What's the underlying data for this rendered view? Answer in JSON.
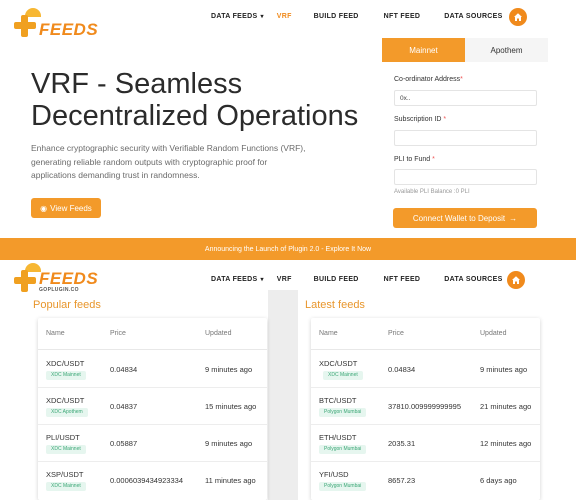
{
  "logo_top": {
    "brand": "FEEDS",
    "sub": ""
  },
  "logo_bottom": {
    "brand": "FEEDS",
    "sub": "GOPLUGIN.CO"
  },
  "nav": {
    "items": [
      {
        "label": "DATA FEEDS",
        "has_caret": true
      },
      {
        "label": "VRF",
        "active": true
      },
      {
        "label": "BUILD FEED"
      },
      {
        "label": "NFT FEED"
      },
      {
        "label": "DATA SOURCES"
      }
    ]
  },
  "nav2": {
    "items": [
      {
        "label": "DATA FEEDS",
        "has_caret": true
      },
      {
        "label": "VRF"
      },
      {
        "label": "BUILD FEED"
      },
      {
        "label": "NFT FEED"
      },
      {
        "label": "DATA SOURCES"
      }
    ]
  },
  "hero": {
    "title_line1": "VRF - Seamless",
    "title_line2": "Decentralized Operations",
    "description": "Enhance cryptographic security with Verifiable Random Functions (VRF), generating reliable random outputs with cryptographic proof for applications demanding trust in randomness.",
    "view_button": "View Feeds"
  },
  "form": {
    "tabs": [
      "Mainnet",
      "Apothem"
    ],
    "coordinator_label": "Co-ordinator Address",
    "coordinator_value": "0x..",
    "subscription_label": "Subscription ID",
    "subscription_value": "",
    "pli_label": "PLI to Fund",
    "pli_value": "",
    "balance_text": "Available PLI Balance :0 PLI",
    "connect_button": "Connect Wallet to Deposit"
  },
  "banner": {
    "text": "Announcing the Launch of Plugin 2.0 - Explore It Now"
  },
  "popular": {
    "title": "Popular feeds",
    "headers": {
      "name": "Name",
      "price": "Price",
      "updated": "Updated"
    },
    "rows": [
      {
        "pair": "XDC/USDT",
        "network": "XDC Mainnet",
        "price": "0.04834",
        "updated": "9 minutes ago"
      },
      {
        "pair": "XDC/USDT",
        "network": "XDC Apothem",
        "price": "0.04837",
        "updated": "15 minutes ago"
      },
      {
        "pair": "PLI/USDT",
        "network": "XDC Mainnet",
        "price": "0.05887",
        "updated": "9 minutes ago"
      },
      {
        "pair": "XSP/USDT",
        "network": "XDC Mainnet",
        "price": "0.0006039434923334",
        "updated": "11 minutes ago"
      }
    ]
  },
  "latest": {
    "title": "Latest feeds",
    "headers": {
      "name": "Name",
      "price": "Price",
      "updated": "Updated"
    },
    "rows": [
      {
        "pair": "XDC/USDT",
        "network": "XDC Mainnet",
        "price": "0.04834",
        "updated": "9 minutes ago"
      },
      {
        "pair": "BTC/USDT",
        "network": "Polygon Mumbai",
        "price": "37810.009999999995",
        "updated": "21 minutes ago"
      },
      {
        "pair": "ETH/USDT",
        "network": "Polygon Mumbai",
        "price": "2035.31",
        "updated": "12 minutes ago"
      },
      {
        "pair": "YFI/USD",
        "network": "Polygon Mumbai",
        "price": "8657.23",
        "updated": "6 days ago"
      }
    ]
  },
  "colors": {
    "accent": "#f39a2a",
    "badge_bg": "#e6f6ef",
    "badge_text": "#3ba776"
  }
}
